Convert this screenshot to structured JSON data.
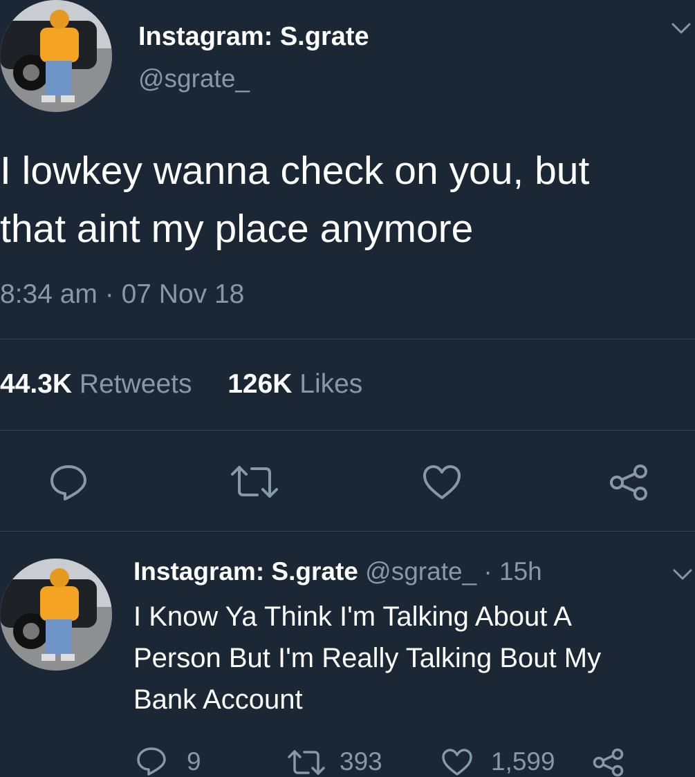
{
  "main_tweet": {
    "display_name": "Instagram: S.grate",
    "handle": "@sgrate_",
    "text_line1": "I lowkey wanna check on you, but",
    "text_line2": "that aint my place anymore",
    "timestamp": "8:34 am · 07 Nov 18",
    "retweets_count": "44.3K",
    "retweets_label": "Retweets",
    "likes_count": "126K",
    "likes_label": "Likes"
  },
  "reply": {
    "display_name": "Instagram: S.grate",
    "handle": "@sgrate_",
    "separator": "·",
    "time_ago": "15h",
    "text_line1": "I Know Ya Think I'm Talking About A",
    "text_line2": "Person But I'm Really Talking Bout My",
    "text_line3": "Bank Account",
    "reply_count": "9",
    "retweet_count": "393",
    "like_count": "1,599"
  },
  "icons": {
    "reply": "reply-icon",
    "retweet": "retweet-icon",
    "like": "heart-icon",
    "share": "share-icon",
    "menu": "chevron-down-icon"
  },
  "colors": {
    "background": "#1b2734",
    "text": "#ffffff",
    "muted": "#8899a6",
    "divider": "#38444d"
  }
}
